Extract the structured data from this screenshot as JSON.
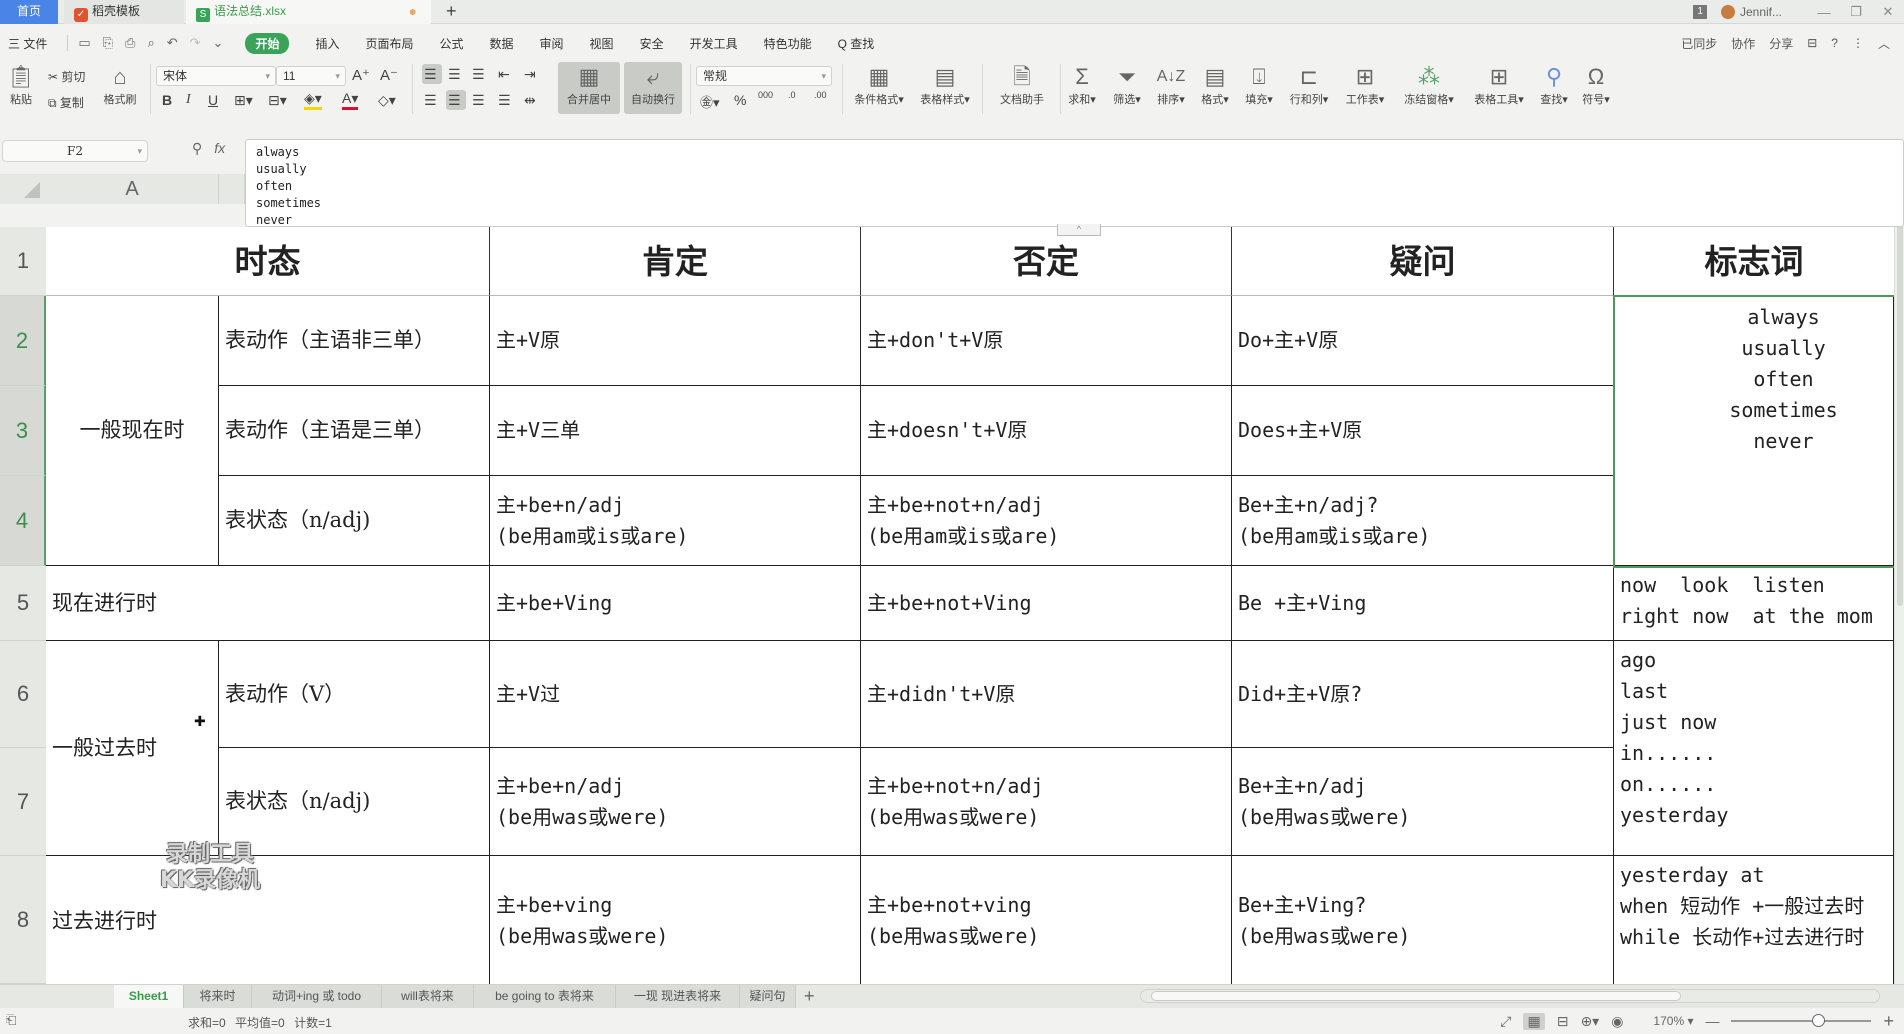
{
  "titlebar": {
    "tabs": [
      {
        "label": "首页",
        "active": false
      },
      {
        "label": "稻壳模板",
        "icon": "docer-icon"
      },
      {
        "label": "语法总结.xlsx",
        "icon": "spreadsheet-icon",
        "active": true,
        "unsaved": true
      }
    ],
    "new_tab": "+",
    "badge": "1",
    "user": "Jennif..."
  },
  "menubar": {
    "file": "三 文件",
    "items": [
      "开始",
      "插入",
      "页面布局",
      "公式",
      "数据",
      "审阅",
      "视图",
      "安全",
      "开发工具",
      "特色功能",
      "Q 查找"
    ],
    "active": "开始",
    "right": [
      "已同步",
      "协作",
      "分享",
      "?"
    ]
  },
  "ribbon": {
    "paste": "粘贴",
    "cut": "剪切",
    "copy": "复制",
    "format_painter": "格式刷",
    "font_name": "宋体",
    "font_size": "11",
    "bold": "B",
    "italic": "I",
    "underline": "U",
    "merge_center": "合并居中",
    "wrap_text": "自动换行",
    "number_format": "常规",
    "percent": "%",
    "conditional_format": "条件格式",
    "table_style": "表格样式",
    "doc_assistant": "文档助手",
    "sum": "求和",
    "filter": "筛选",
    "sort": "排序",
    "format": "格式",
    "fill": "填充",
    "row_col": "行和列",
    "worksheet": "工作表",
    "freeze": "冻结窗格",
    "table_tools": "表格工具",
    "find": "查找",
    "symbol": "符号"
  },
  "formula_bar": {
    "cell_ref": "F2",
    "fx": "fx",
    "content_lines": [
      "always",
      "usually",
      "often",
      "sometimes",
      "never"
    ]
  },
  "column_header_visible": "A",
  "rows": [
    "1",
    "2",
    "3",
    "4",
    "5",
    "6",
    "7",
    "8"
  ],
  "table": {
    "headers": {
      "tense": "时态",
      "affirmative": "肯定",
      "negative": "否定",
      "question": "疑问",
      "signal_words": "标志词"
    },
    "r2": {
      "a": "一般现在时",
      "b": "表动作（主语非三单）",
      "c": "主+V原",
      "d": "主+don't+V原",
      "e": "Do+主+V原",
      "f": "always\nusually\noften\nsometimes\nnever"
    },
    "r3": {
      "b": "表动作（主语是三单）",
      "c": "主+V三单",
      "d": "主+doesn't+V原",
      "e": "Does+主+V原"
    },
    "r4": {
      "b": "表状态（n/adj)",
      "c": "主+be+n/adj\n(be用am或is或are)",
      "d": "主+be+not+n/adj\n(be用am或is或are)",
      "e": "Be+主+n/adj?\n(be用am或is或are)"
    },
    "r5": {
      "a": "现在进行时",
      "c": "主+be+Ving",
      "d": "主+be+not+Ving",
      "e": "Be +主+Ving",
      "f": "now  look  listen\nright now  at the mom"
    },
    "r6": {
      "a": "一般过去时",
      "b": "表动作（V）",
      "c": "主+V过",
      "d": "主+didn't+V原",
      "e": "Did+主+V原?",
      "f": "ago\nlast\njust now\nin......\non......\nyesterday"
    },
    "r7": {
      "b": "表状态（n/adj)",
      "c": "主+be+n/adj\n(be用was或were)",
      "d": "主+be+not+n/adj\n(be用was或were)",
      "e": "Be+主+n/adj\n(be用was或were)"
    },
    "r8": {
      "a": "过去进行时",
      "c": "主+be+ving\n(be用was或were)",
      "d": "主+be+not+ving\n(be用was或were)",
      "e": "Be+主+Ving?\n(be用was或were)",
      "f": "yesterday at\nwhen 短动作 +一般过去时\nwhile 长动作+过去进行时"
    }
  },
  "watermark": {
    "line1": "录制工具",
    "line2": "KK录像机"
  },
  "sheet_tabs": [
    "Sheet1",
    "将来时",
    "动词+ing 或 todo",
    "will表将来",
    "be going to 表将来",
    "一现 现进表将来",
    "疑问句"
  ],
  "active_sheet": "Sheet1",
  "status": {
    "sum": "求和=0",
    "average": "平均值=0",
    "count": "计数=1",
    "zoom": "170%",
    "zoom_fraction": 0.62
  }
}
